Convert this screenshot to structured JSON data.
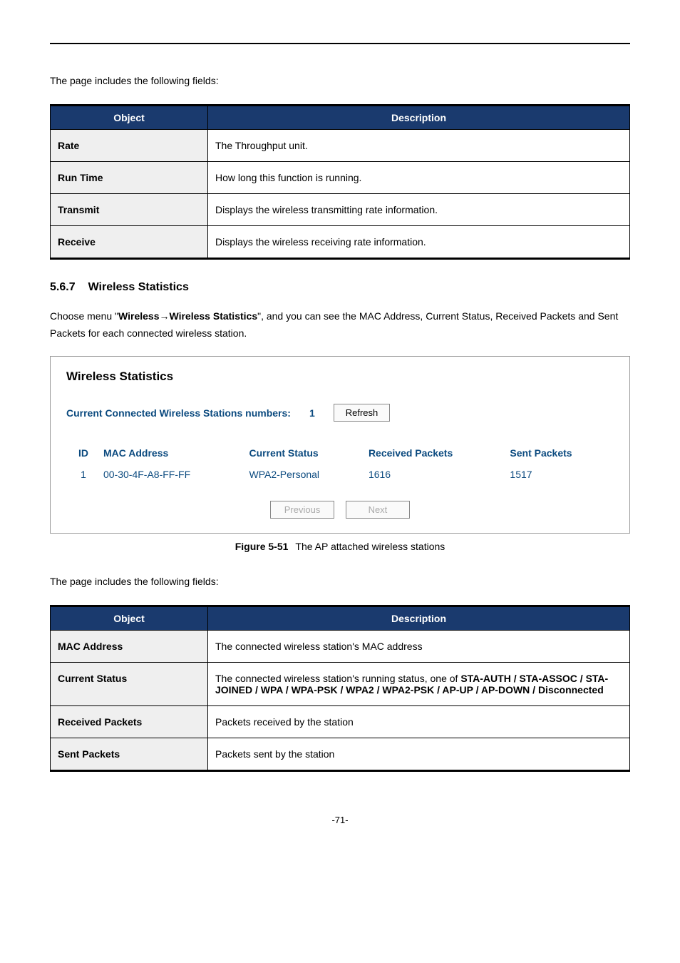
{
  "intro1": "The page includes the following fields:",
  "table1": {
    "headers": {
      "object": "Object",
      "description": "Description"
    },
    "rows": [
      {
        "obj": "Rate",
        "desc": "The Throughput unit."
      },
      {
        "obj": "Run Time",
        "desc": "How long this function is running."
      },
      {
        "obj": "Transmit",
        "desc": "Displays the wireless transmitting rate information."
      },
      {
        "obj": "Receive",
        "desc": "Displays the wireless receiving rate information."
      }
    ]
  },
  "section": {
    "number": "5.6.7",
    "title": "Wireless Statistics"
  },
  "section_para": {
    "pre": "Choose menu \"",
    "bold1": "Wireless",
    "arrow": "→",
    "bold2": "Wireless Statistics",
    "post": "\", and you can see the MAC Address, Current Status, Received Packets and Sent Packets for each connected wireless station."
  },
  "panel": {
    "title": "Wireless Statistics",
    "conn_label": "Current Connected Wireless Stations numbers:",
    "conn_count": "1",
    "refresh": "Refresh",
    "headers": {
      "id": "ID",
      "mac": "MAC Address",
      "status": "Current Status",
      "recv": "Received Packets",
      "sent": "Sent Packets"
    },
    "rows": [
      {
        "id": "1",
        "mac": "00-30-4F-A8-FF-FF",
        "status": "WPA2-Personal",
        "recv": "1616",
        "sent": "1517"
      }
    ],
    "prev": "Previous",
    "next": "Next"
  },
  "figure": {
    "label": "Figure 5-51",
    "caption": "The AP attached wireless stations"
  },
  "intro2": "The page includes the following fields:",
  "table2": {
    "headers": {
      "object": "Object",
      "description": "Description"
    },
    "rows": [
      {
        "obj": "MAC Address",
        "desc_plain": "The connected wireless station's MAC address"
      },
      {
        "obj": "Current Status",
        "desc_pre": "The connected wireless station's running status, one of ",
        "desc_bold": "STA-AUTH / STA-ASSOC / STA-JOINED / WPA / WPA-PSK / WPA2 / WPA2-PSK / AP-UP / AP-DOWN / Disconnected"
      },
      {
        "obj": "Received Packets",
        "desc_plain": "Packets received by the station"
      },
      {
        "obj": "Sent Packets",
        "desc_plain": "Packets sent by the station"
      }
    ]
  },
  "page_number": "-71-"
}
